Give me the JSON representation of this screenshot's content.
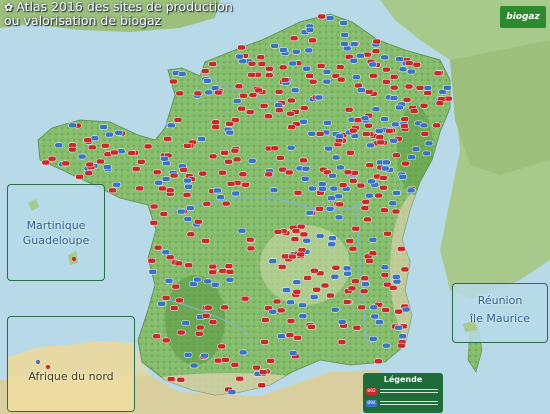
{
  "title": {
    "line1": "Atlas 2016 des sites de production",
    "line2": "ou valorisation de biogaz",
    "icon": "gear-icon"
  },
  "logo": {
    "text": "biogaz",
    "color": "#2d8a2d"
  },
  "insets": {
    "antilles": {
      "label1": "Martinique",
      "label2": "Guadeloupe"
    },
    "reunion": {
      "label1": "Réunion",
      "label2": "île Maurice"
    },
    "afrique": {
      "label": "Afrique du nord"
    }
  },
  "legend": {
    "title": "Légende",
    "entries": [
      {
        "code": "892",
        "color": "#c62a2a"
      },
      {
        "code": "894",
        "color": "#3a72c4"
      }
    ]
  },
  "colors": {
    "sea": "#b7d9e8",
    "land": "#7fb866",
    "forest": "#4f9a3f",
    "mountain": "#d8cfa9",
    "marker_agricultural": "#c62a2a",
    "marker_industrial": "#3a72c4"
  }
}
